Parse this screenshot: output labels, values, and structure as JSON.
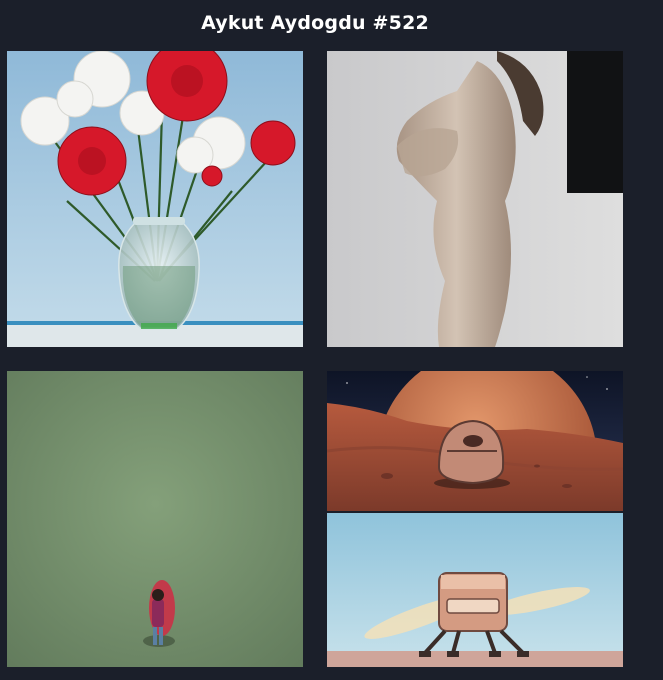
{
  "header": {
    "title": "Aykut Aydogdu #522"
  },
  "colors": {
    "background": "#1b1f2a",
    "title_text": "#ffffff"
  },
  "gallery": {
    "images": [
      {
        "name": "flowers-vase-image"
      },
      {
        "name": "figure-studio-image"
      },
      {
        "name": "person-on-grass-image"
      },
      {
        "name": "mars-pod-image"
      },
      {
        "name": "drone-lander-image"
      }
    ]
  }
}
